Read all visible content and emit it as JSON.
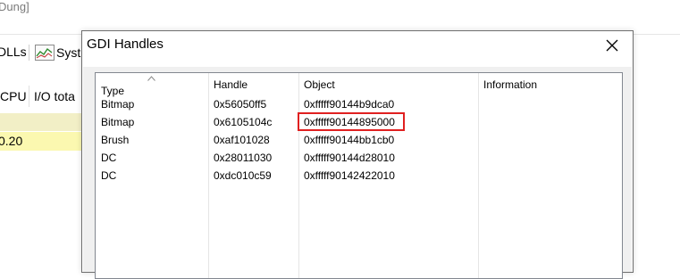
{
  "background_app": {
    "title_fragment": "Dung]",
    "toolbar": {
      "dlls_label": "DLLs",
      "system_label": "Syst"
    },
    "columns": {
      "cpu": "CPU",
      "io_total": "I/O tota"
    },
    "row_value": "0.20"
  },
  "dialog": {
    "title": "GDI Handles",
    "close_icon": "close-icon",
    "columns": [
      "Type",
      "Handle",
      "Object",
      "Information"
    ],
    "rows": [
      {
        "type": "Bitmap",
        "handle": "0x56050ff5",
        "object": "0xfffff90144b9dca0",
        "information": ""
      },
      {
        "type": "Bitmap",
        "handle": "0x6105104c",
        "object": "0xfffff90144895000",
        "information": ""
      },
      {
        "type": "Brush",
        "handle": "0xaf101028",
        "object": "0xfffff90144bb1cb0",
        "information": ""
      },
      {
        "type": "DC",
        "handle": "0x28011030",
        "object": "0xfffff90144d28010",
        "information": ""
      },
      {
        "type": "DC",
        "handle": "0xdc010c59",
        "object": "0xfffff90142422010",
        "information": ""
      }
    ],
    "highlight_color": "#e02020",
    "sort_column": "Type"
  },
  "colors": {
    "row_selected_1": "#f2efc6",
    "row_selected_2": "#fbf8b0",
    "dialog_border": "#6f6f6f"
  }
}
